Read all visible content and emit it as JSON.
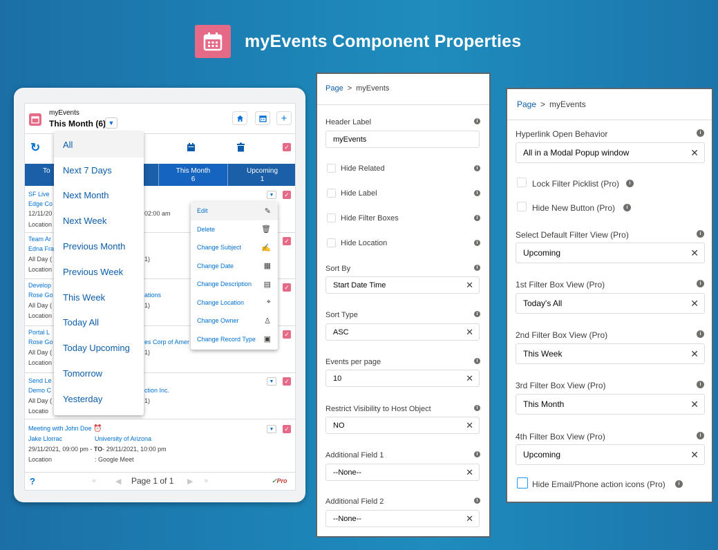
{
  "title": "myEvents Component Properties",
  "component": {
    "header_label": "myEvents",
    "current_filter": "This Month (6)",
    "filter_tabs": [
      {
        "label": "To",
        "count": ""
      },
      {
        "label": "This Month",
        "count": "6"
      },
      {
        "label": "Upcoming",
        "count": "1"
      }
    ],
    "filter_menu": [
      "All",
      "Next 7 Days",
      "Next Month",
      "Next Week",
      "Previous Month",
      "Previous Week",
      "This Week",
      "Today All",
      "Today Upcoming",
      "Tomorrow",
      "Yesterday"
    ],
    "context_menu": [
      {
        "label": "Edit",
        "icon": "pencil-icon"
      },
      {
        "label": "Delete",
        "icon": "trash-icon"
      },
      {
        "label": "Change Subject",
        "icon": "edit-subject-icon"
      },
      {
        "label": "Change Date",
        "icon": "calendar-icon"
      },
      {
        "label": "Change Description",
        "icon": "description-icon"
      },
      {
        "label": "Change Location",
        "icon": "location-icon"
      },
      {
        "label": "Change Owner",
        "icon": "owner-icon"
      },
      {
        "label": "Change Record Type",
        "icon": "record-type-icon"
      }
    ],
    "events": [
      {
        "subject": "SF Live",
        "who": "Edge Co",
        "what": "",
        "date": "12/11/20",
        "time_extra": "02:00 am",
        "location": "Location"
      },
      {
        "subject": "Team Ar",
        "who": "Edna Fra",
        "what": "",
        "date": "All Day (",
        "time_extra": "1)",
        "location": "Location"
      },
      {
        "subject": "Develop",
        "who": "Rose Go",
        "what": "ations",
        "date": "All Day (",
        "time_extra": "1)",
        "location": "Location"
      },
      {
        "subject": "Portal L",
        "who": "Rose Go",
        "what": "es Corp of Amer",
        "date": "All Day (",
        "time_extra": "1)",
        "location": "Location"
      },
      {
        "subject": "Send Le",
        "who": "Demo C",
        "what": "ction Inc.",
        "date": "All Day (",
        "time_extra": "1)",
        "location": "Locatio"
      },
      {
        "subject": "Meeting with John Doe",
        "who": "Jake Llorrac",
        "what": "University of Arizona",
        "date": "29/11/2021, 09:00 pm - ",
        "to": "TO",
        "date_end": "- 29/11/2021, 10:00 pm",
        "location": "Location",
        "location_value": ": Google Meet"
      }
    ],
    "footer": {
      "help": "?",
      "page_text": "Page 1 of 1",
      "pro": "Pro"
    }
  },
  "panel1": {
    "breadcrumb_root": "Page",
    "breadcrumb_current": "myEvents",
    "fields": [
      {
        "label": "Header Label",
        "value": "myEvents",
        "clearable": false
      },
      {
        "label": "Sort By",
        "value": "Start Date Time",
        "clearable": true
      },
      {
        "label": "Sort Type",
        "value": "ASC",
        "clearable": true
      },
      {
        "label": "Events per page",
        "value": "10",
        "clearable": true
      },
      {
        "label": "Restrict Visibility to Host Object",
        "value": "NO",
        "clearable": true
      },
      {
        "label": "Additional Field 1",
        "value": "--None--",
        "clearable": true
      },
      {
        "label": "Additional Field 2",
        "value": "--None--",
        "clearable": true
      }
    ],
    "checkboxes": [
      "Hide Related",
      "Hide Label",
      "Hide Filter Boxes",
      "Hide Location"
    ]
  },
  "panel2": {
    "breadcrumb_root": "Page",
    "breadcrumb_current": "myEvents",
    "fields": [
      {
        "label": "Hyperlink Open Behavior",
        "value": "All in a Modal Popup window"
      },
      {
        "label": "Select Default Filter View (Pro)",
        "value": "Upcoming"
      },
      {
        "label": "1st Filter Box View (Pro)",
        "value": "Today's All"
      },
      {
        "label": "2nd Filter Box View (Pro)",
        "value": "This Week"
      },
      {
        "label": "3rd Filter Box View (Pro)",
        "value": "This Month"
      },
      {
        "label": "4th Filter Box View (Pro)",
        "value": "Upcoming"
      }
    ],
    "checkboxes": [
      "Lock Filter Picklist (Pro)",
      "Hide New Button (Pro)",
      "Hide Email/Phone action icons (Pro)"
    ]
  },
  "colors": {
    "background": "#1a7ab0",
    "accent": "#e46a87",
    "brand_blue": "#0070d2",
    "filter_bar": "#1a5fa8"
  }
}
